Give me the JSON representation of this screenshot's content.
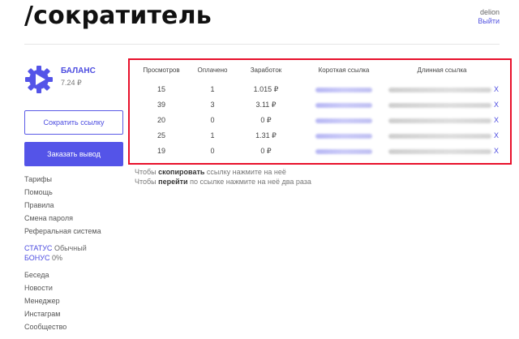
{
  "header": {
    "logo": "/сократитель",
    "username": "delion",
    "logout_label": "Выйти"
  },
  "balance": {
    "label": "БАЛАНС",
    "value": "7.24 ₽",
    "icon": "gear-play-icon",
    "accent": "#5454e8"
  },
  "buttons": {
    "shorten_label": "Сократить ссылку",
    "withdraw_label": "Заказать вывод"
  },
  "menu": {
    "items": [
      "Тарифы",
      "Помощь",
      "Правила",
      "Смена пароля",
      "Реферальная система"
    ],
    "status_key": "СТАТУС",
    "status_value": "Обычный",
    "bonus_key": "БОНУС",
    "bonus_value": "0%",
    "items2": [
      "Беседа",
      "Новости",
      "Менеджер",
      "Инстаграм",
      "Сообщество"
    ]
  },
  "table": {
    "headers": [
      "Просмотров",
      "Оплачено",
      "Заработок",
      "Короткая ссылка",
      "Длинная ссылка"
    ],
    "rows": [
      {
        "views": "15",
        "paid": "1",
        "earned": "1.015 ₽",
        "delete": "X"
      },
      {
        "views": "39",
        "paid": "3",
        "earned": "3.11 ₽",
        "delete": "X"
      },
      {
        "views": "20",
        "paid": "0",
        "earned": "0 ₽",
        "delete": "X"
      },
      {
        "views": "25",
        "paid": "1",
        "earned": "1.31 ₽",
        "delete": "X"
      },
      {
        "views": "19",
        "paid": "0",
        "earned": "0 ₽",
        "delete": "X"
      }
    ],
    "highlight_color": "#e8102b"
  },
  "hints": {
    "copy_prefix": "Чтобы",
    "copy_word": "скопировать",
    "copy_suffix": "ссылку нажмите на неё",
    "open_prefix": "Чтобы",
    "open_word": "перейти",
    "open_suffix": "по ссылке нажмите на неё два раза"
  }
}
